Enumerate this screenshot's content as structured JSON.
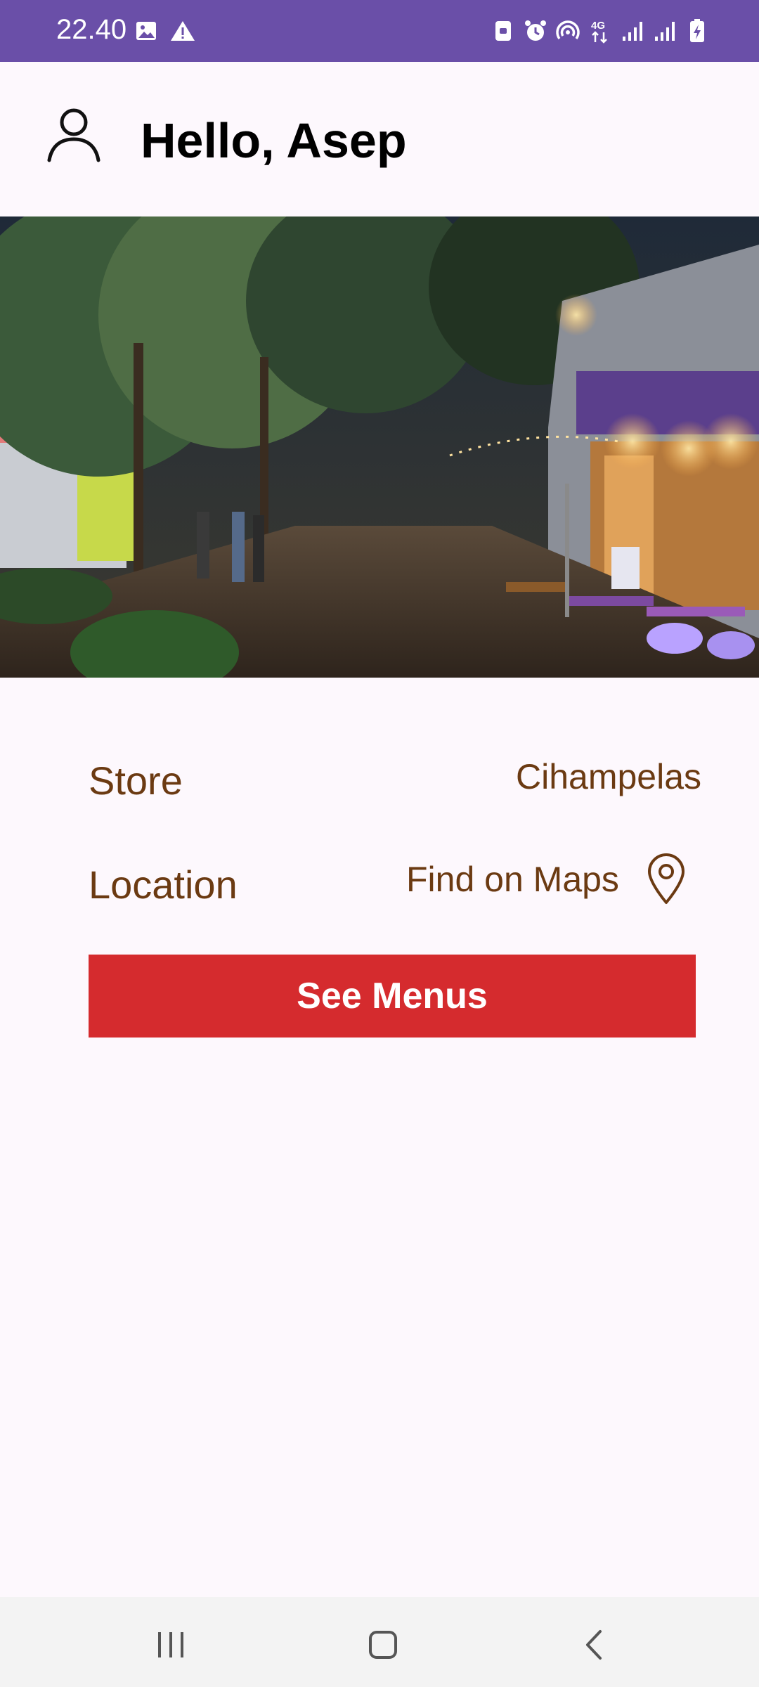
{
  "status_bar": {
    "time": "22.40",
    "left_icons": [
      "image-icon",
      "warning-icon"
    ],
    "right_icons": [
      "screenshot-icon",
      "alarm-icon",
      "hotspot-icon",
      "4g-icon",
      "signal-icon",
      "signal-icon",
      "battery-charging-icon"
    ],
    "network_label": "4G",
    "background": "#6a4fa8"
  },
  "header": {
    "greeting": "Hello, Asep",
    "avatar_icon": "person-icon"
  },
  "hero": {
    "description_icon": "store-photo"
  },
  "store": {
    "label": "Store",
    "value": "Cihampelas"
  },
  "location": {
    "label": "Location",
    "value": "Find on Maps",
    "icon": "map-pin-icon"
  },
  "actions": {
    "see_menus": "See Menus",
    "button_color": "#d52b2e"
  },
  "nav_bar": {
    "items": [
      "recents-icon",
      "home-icon",
      "back-icon"
    ]
  },
  "colors": {
    "accent_text": "#6b3a12",
    "background": "#fdf8fd"
  }
}
